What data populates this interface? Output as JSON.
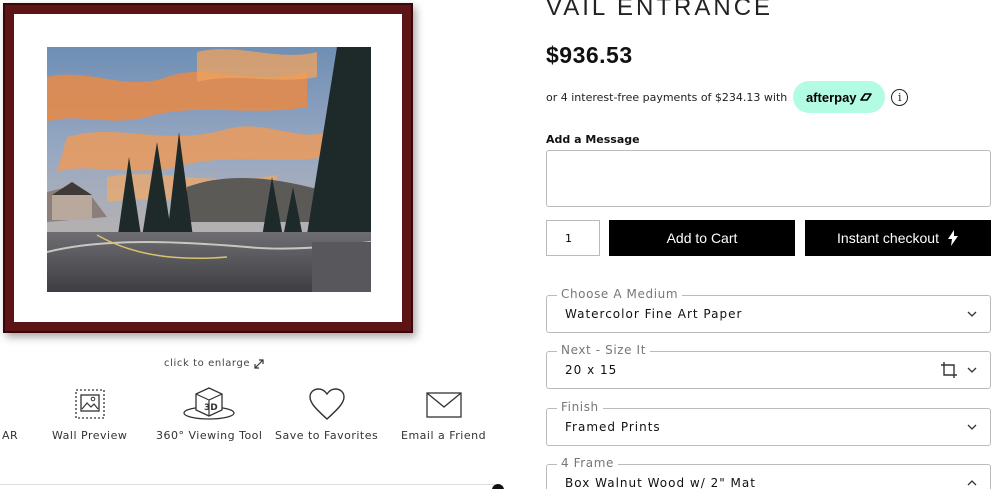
{
  "product": {
    "title": "VAIL ENTRANCE",
    "price": "$936.53",
    "installments_text": "or 4 interest-free payments of $234.13 with",
    "afterpay_label": "afterpay",
    "info_icon": "i"
  },
  "artwork": {
    "frame_color": "#5c1416",
    "enlarge_label": "click to enlarge"
  },
  "tools": [
    {
      "label": "AR",
      "icon": "ar-icon"
    },
    {
      "label": "Wall Preview",
      "icon": "wall-preview-icon"
    },
    {
      "label": "360° Viewing Tool",
      "icon": "3d-view-icon"
    },
    {
      "label": "Save to Favorites",
      "icon": "heart-icon"
    },
    {
      "label": "Email a Friend",
      "icon": "envelope-icon"
    }
  ],
  "message": {
    "label": "Add a Message",
    "value": ""
  },
  "cart": {
    "quantity": "1",
    "add_to_cart_label": "Add to Cart",
    "instant_checkout_label": "Instant checkout"
  },
  "options": {
    "medium": {
      "legend": "Choose A Medium",
      "value": "Watercolor Fine Art Paper"
    },
    "size": {
      "legend": "Next - Size It",
      "value": "20 x 15"
    },
    "finish": {
      "legend": "Finish",
      "value": "Framed Prints"
    },
    "frame": {
      "legend": "4 Frame",
      "value": "Box Walnut Wood w/ 2\" Mat"
    }
  },
  "colors": {
    "button_bg": "#000000",
    "afterpay_bg": "#b2fce4"
  }
}
